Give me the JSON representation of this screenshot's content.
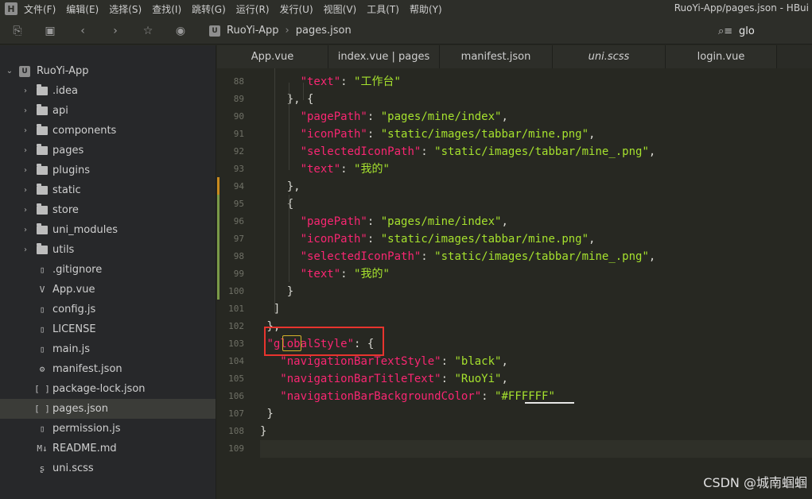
{
  "app": {
    "logo_letter": "H",
    "window_title": "RuoYi-App/pages.json - HBui"
  },
  "menu": [
    "文件(F)",
    "编辑(E)",
    "选择(S)",
    "查找(I)",
    "跳转(G)",
    "运行(R)",
    "发行(U)",
    "视图(V)",
    "工具(T)",
    "帮助(Y)"
  ],
  "toolbar": {
    "icons": [
      "new-file-icon",
      "save-icon",
      "back-icon",
      "forward-icon",
      "star-icon",
      "run-icon"
    ],
    "breadcrumb": {
      "project_icon": "U",
      "project": "RuoYi-App",
      "file": "pages.json"
    },
    "search": {
      "value": "glo"
    }
  },
  "sidebar": {
    "root": "RuoYi-App",
    "root_icon": "U",
    "items": [
      {
        "label": ".idea",
        "type": "folder"
      },
      {
        "label": "api",
        "type": "folder"
      },
      {
        "label": "components",
        "type": "folder"
      },
      {
        "label": "pages",
        "type": "folder"
      },
      {
        "label": "plugins",
        "type": "folder"
      },
      {
        "label": "static",
        "type": "folder"
      },
      {
        "label": "store",
        "type": "folder"
      },
      {
        "label": "uni_modules",
        "type": "folder"
      },
      {
        "label": "utils",
        "type": "folder"
      },
      {
        "label": ".gitignore",
        "type": "file",
        "icon": "▯"
      },
      {
        "label": "App.vue",
        "type": "file",
        "icon": "V"
      },
      {
        "label": "config.js",
        "type": "file",
        "icon": "▯"
      },
      {
        "label": "LICENSE",
        "type": "file",
        "icon": "▯"
      },
      {
        "label": "main.js",
        "type": "file",
        "icon": "▯"
      },
      {
        "label": "manifest.json",
        "type": "file",
        "icon": "⚙"
      },
      {
        "label": "package-lock.json",
        "type": "file",
        "icon": "[ ]"
      },
      {
        "label": "pages.json",
        "type": "file",
        "icon": "[ ]",
        "selected": true
      },
      {
        "label": "permission.js",
        "type": "file",
        "icon": "▯"
      },
      {
        "label": "README.md",
        "type": "file",
        "icon": "M↓"
      },
      {
        "label": "uni.scss",
        "type": "file",
        "icon": "ʂ"
      }
    ]
  },
  "tabs": [
    {
      "label": "App.vue"
    },
    {
      "label": "index.vue | pages"
    },
    {
      "label": "manifest.json"
    },
    {
      "label": "uni.scss",
      "italic": true
    },
    {
      "label": "login.vue"
    }
  ],
  "editor": {
    "lines": [
      {
        "n": "88",
        "code": "      \"text\": \"工作台\""
      },
      {
        "n": "89",
        "code": "    }, {"
      },
      {
        "n": "90",
        "code": "      \"pagePath\": \"pages/mine/index\","
      },
      {
        "n": "91",
        "code": "      \"iconPath\": \"static/images/tabbar/mine.png\","
      },
      {
        "n": "92",
        "code": "      \"selectedIconPath\": \"static/images/tabbar/mine_.png\","
      },
      {
        "n": "93",
        "code": "      \"text\": \"我的\""
      },
      {
        "n": "94",
        "code": "    },"
      },
      {
        "n": "95",
        "code": "    {"
      },
      {
        "n": "96",
        "code": "      \"pagePath\": \"pages/mine/index\","
      },
      {
        "n": "97",
        "code": "      \"iconPath\": \"static/images/tabbar/mine.png\","
      },
      {
        "n": "98",
        "code": "      \"selectedIconPath\": \"static/images/tabbar/mine_.png\","
      },
      {
        "n": "99",
        "code": "      \"text\": \"我的\""
      },
      {
        "n": "100",
        "code": "    }"
      },
      {
        "n": "101",
        "code": "  ]"
      },
      {
        "n": "102",
        "code": " },"
      },
      {
        "n": "103",
        "code": " \"globalStyle\": {"
      },
      {
        "n": "104",
        "code": "   \"navigationBarTextStyle\": \"black\","
      },
      {
        "n": "105",
        "code": "   \"navigationBarTitleText\": \"RuoYi\","
      },
      {
        "n": "106",
        "code": "   \"navigationBarBackgroundColor\": \"#FFFFFF\""
      },
      {
        "n": "107",
        "code": " }"
      },
      {
        "n": "108",
        "code": "}"
      },
      {
        "n": "109",
        "code": ""
      }
    ]
  },
  "watermark": "CSDN @城南蝈蝈",
  "colors": {
    "key": "#f92672",
    "string": "#a6e22e",
    "highlight_box": "#e8342e",
    "word_mark": "#d6b32c",
    "modified_bar": "#7a9a48",
    "changed_bar": "#c98a1e"
  }
}
